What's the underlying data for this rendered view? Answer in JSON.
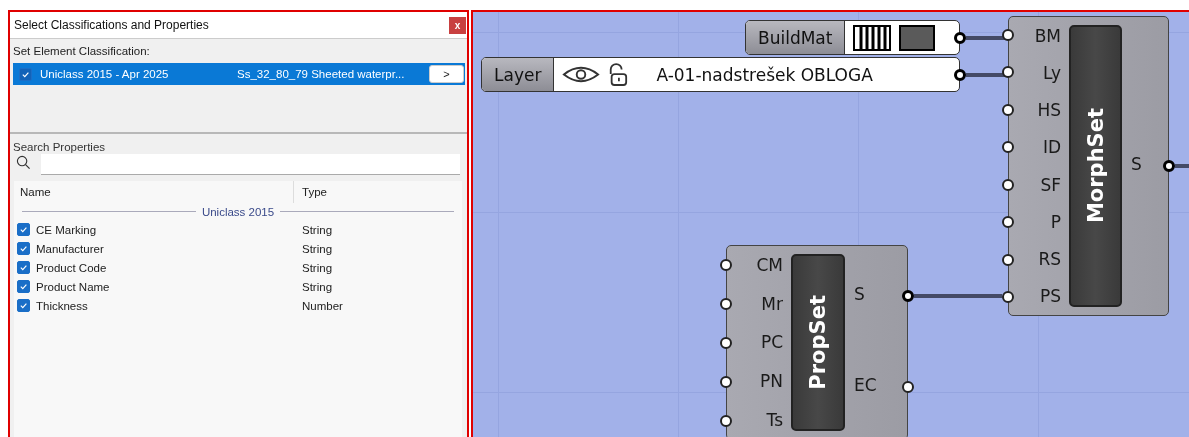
{
  "dialog": {
    "title": "Select Classifications and Properties",
    "close": "x",
    "section_label": "Set Element Classification:",
    "classifications": [
      {
        "system": "Uniclass 2015 - Apr 2025",
        "code": "Ss_32_80_79 Sheeted waterpr...",
        "checked": true,
        "selected": true,
        "button": ">"
      }
    ],
    "search": {
      "label": "Search Properties"
    },
    "table": {
      "columns": [
        "Name",
        "Type"
      ],
      "groups": [
        {
          "name": "Uniclass 2015",
          "rows": [
            {
              "name": "CE Marking",
              "type": "String",
              "checked": true
            },
            {
              "name": "Manufacturer",
              "type": "String",
              "checked": true
            },
            {
              "name": "Product Code",
              "type": "String",
              "checked": true
            },
            {
              "name": "Product Name",
              "type": "String",
              "checked": true
            },
            {
              "name": "Thickness",
              "type": "Number",
              "checked": true
            }
          ]
        }
      ]
    }
  },
  "canvas": {
    "nodes": [
      {
        "kind": "swatch",
        "label": "BuildMat",
        "output_connected": true
      },
      {
        "kind": "layer",
        "label": "Layer",
        "value": "A-01-nadstrešek OBLOGA",
        "visible": true,
        "locked": false,
        "output_connected": true
      },
      {
        "kind": "component",
        "name": "MorphSet",
        "inputs": [
          "BM",
          "Ly",
          "HS",
          "ID",
          "SF",
          "P",
          "RS",
          "PS"
        ],
        "outputs": [
          {
            "name": "S",
            "connected": true
          }
        ]
      },
      {
        "kind": "component",
        "name": "PropSet",
        "inputs": [
          "CM",
          "Mr",
          "PC",
          "PN",
          "Ts"
        ],
        "outputs": [
          {
            "name": "S",
            "connected": true
          },
          {
            "name": "EC",
            "connected": false
          }
        ]
      }
    ]
  }
}
